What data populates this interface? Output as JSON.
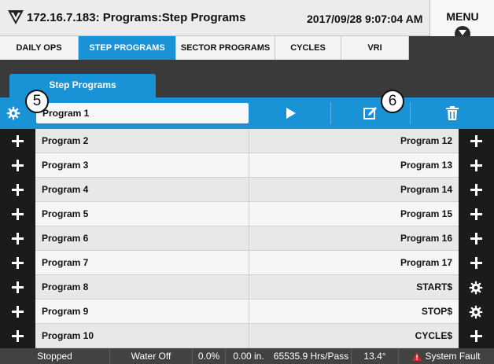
{
  "header": {
    "title": "172.16.7.183: Programs:Step Programs",
    "datetime": "2017/09/28 9:07:04 AM",
    "menu_label": "MENU"
  },
  "nav_tabs": [
    {
      "label": "DAILY OPS",
      "active": false
    },
    {
      "label": "STEP PROGRAMS",
      "active": true
    },
    {
      "label": "SECTOR PROGRAMS",
      "active": false
    },
    {
      "label": "CYCLES",
      "active": false
    },
    {
      "label": "VRI",
      "active": false
    }
  ],
  "subtab": {
    "label": "Step Programs"
  },
  "selected_row": {
    "name": "Program 1",
    "actions": [
      "play-icon",
      "edit-icon",
      "trash-icon"
    ]
  },
  "callouts": [
    "5",
    "6"
  ],
  "rows": [
    {
      "left": "Program 2",
      "right": "Program 12",
      "right_icon": "plus-icon"
    },
    {
      "left": "Program 3",
      "right": "Program 13",
      "right_icon": "plus-icon"
    },
    {
      "left": "Program 4",
      "right": "Program 14",
      "right_icon": "plus-icon"
    },
    {
      "left": "Program 5",
      "right": "Program 15",
      "right_icon": "plus-icon"
    },
    {
      "left": "Program 6",
      "right": "Program 16",
      "right_icon": "plus-icon"
    },
    {
      "left": "Program 7",
      "right": "Program 17",
      "right_icon": "plus-icon"
    },
    {
      "left": "Program 8",
      "right": "START$",
      "right_icon": "gear-icon"
    },
    {
      "left": "Program 9",
      "right": "STOP$",
      "right_icon": "gear-icon"
    },
    {
      "left": "Program 10",
      "right": "CYCLE$",
      "right_icon": "plus-icon"
    }
  ],
  "status": {
    "state": "Stopped",
    "water": "Water Off",
    "percent": "0.0%",
    "depth": "0.00 in.",
    "rate": "65535.9 Hrs/Pass",
    "angle": "13.4°",
    "fault": "System Fault"
  },
  "colors": {
    "accent": "#1a92d6",
    "dark": "#1b1b1b",
    "fault": "#d9262c"
  }
}
